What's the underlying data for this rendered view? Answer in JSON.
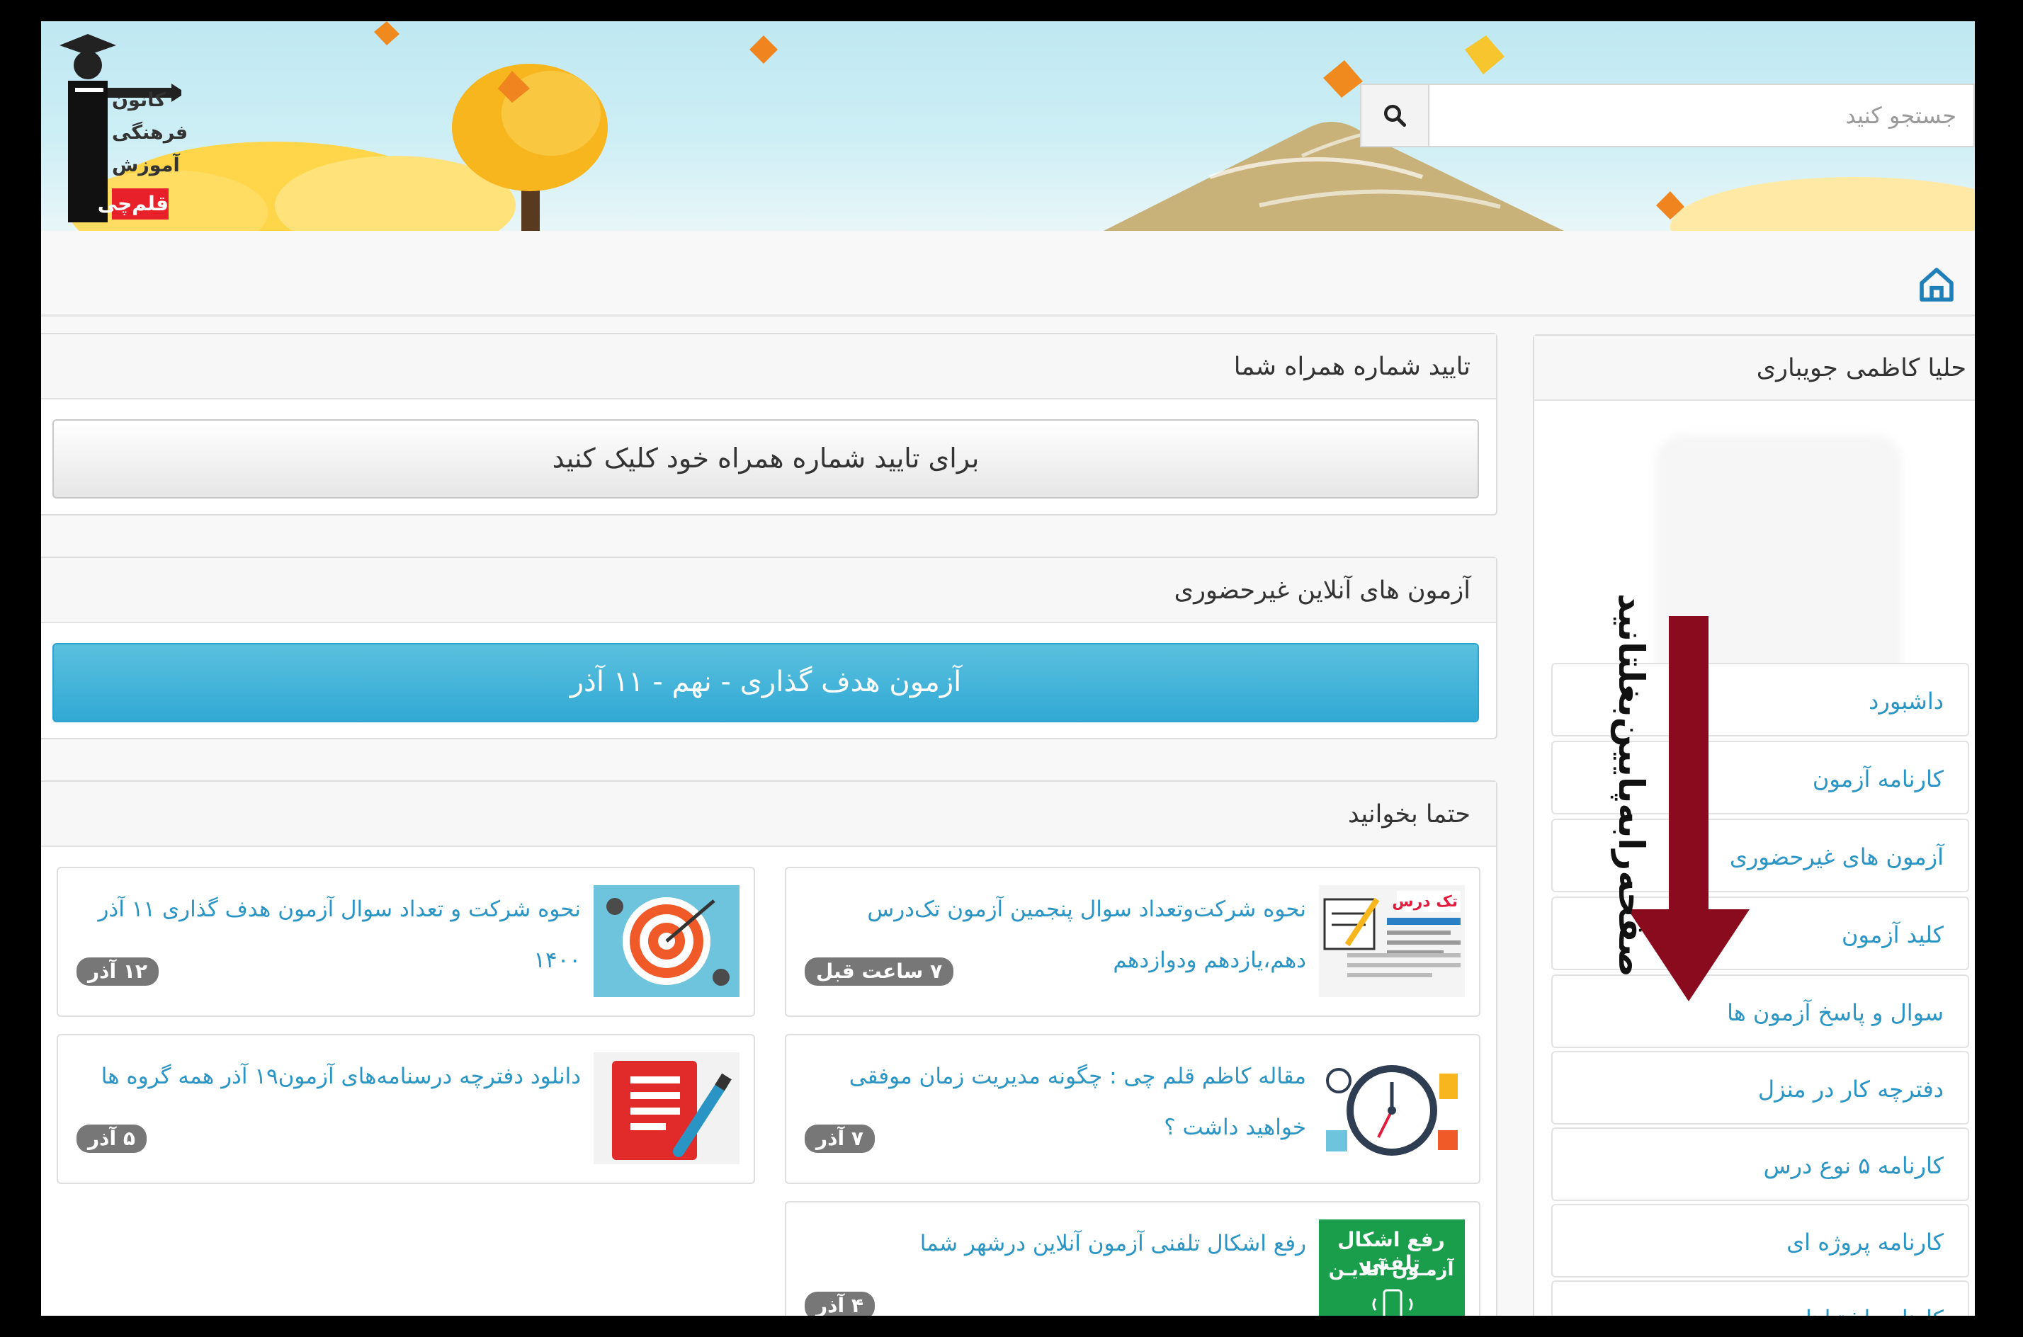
{
  "header": {
    "logo": {
      "line1": "کانون",
      "line2": "فرهنگی",
      "line3": "آموزش",
      "line4": "قلم‌چی"
    },
    "search": {
      "placeholder": "جستجو کنید"
    }
  },
  "phone_panel": {
    "title": "تایید شماره همراه شما",
    "button_label": "برای تایید شماره همراه خود کلیک کنید"
  },
  "online_exams_panel": {
    "title": "آزمون های آنلاین غیرحضوری",
    "exam_button_label": "آزمون هدف گذاری - نهم - ۱۱ آذر"
  },
  "must_read": {
    "title": "حتما بخوانید",
    "items": [
      {
        "title": "نحوه شرکت‌وتعداد سوال پنجمین آزمون تک‌درس دهم،یازدهم ودوازدهم",
        "badge": "۷ ساعت قبل",
        "thumb": "single-subject-exam-thumb"
      },
      {
        "title": "نحوه شرکت و تعداد سوال آزمون هدف گذاری ۱۱ آذر ۱۴۰۰",
        "badge": "۱۲ آذر",
        "thumb": "target-thumb"
      },
      {
        "title": "مقاله کاظم قلم چی : چگونه مدیریت زمان موفقی خواهید داشت ؟",
        "badge": "۷ آذر",
        "thumb": "clock-thumb"
      },
      {
        "title": "دانلود دفترچه درسنامه‌های آزمون۱۹ آذر همه گروه ها",
        "badge": "۵ آذر",
        "thumb": "notebook-thumb"
      },
      {
        "title": "رفع اشکال تلفنی آزمون آنلاین درشهر شما",
        "badge": "۴ آذر",
        "thumb": "phone-support-thumb",
        "thumb_text1": "رفع اشکال تلفنی",
        "thumb_text2": "آزمـون آنلایـن"
      }
    ]
  },
  "sidebar": {
    "user_name": "حلیا کاظمی جویباری",
    "items": [
      {
        "label": "داشبورد"
      },
      {
        "label": "کارنامه آزمون"
      },
      {
        "label": "آزمون های غیرحضوری"
      },
      {
        "label": "کلید آزمون"
      },
      {
        "label": "سوال و پاسخ آزمون ها"
      },
      {
        "label": "دفترچه کار در منزل"
      },
      {
        "label": "کارنامه ۵ نوع درس"
      },
      {
        "label": "کارنامه پروژه ای"
      },
      {
        "label": "کارنامه اشتباهات"
      }
    ]
  },
  "overlay": {
    "scroll_hint": "صفحه‌رابه‌پایین‌بغلتانید"
  },
  "colors": {
    "link": "#2a95c5",
    "primary_button": "#31a9d4",
    "arrow": "#8a0b1d",
    "badge": "#777777"
  }
}
